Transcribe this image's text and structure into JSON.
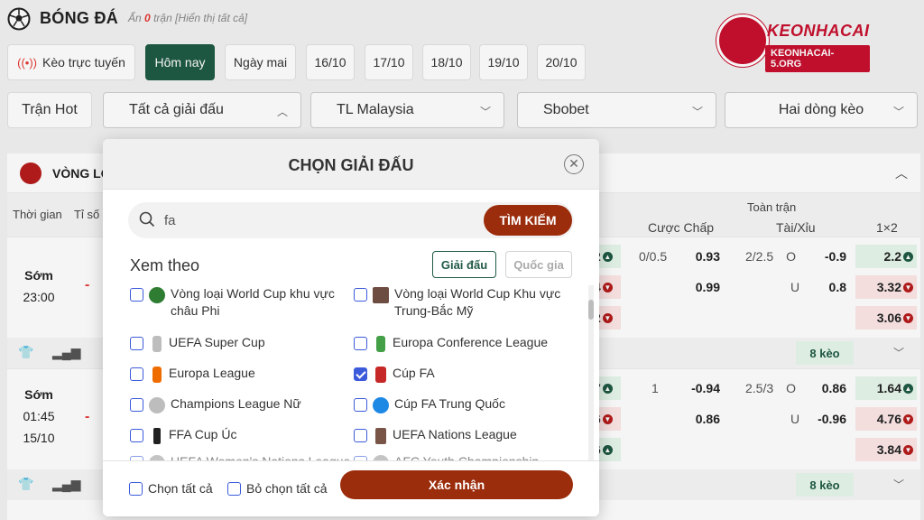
{
  "header": {
    "title": "BÓNG ĐÁ",
    "hidden_prefix": "Ẩn",
    "hidden_count": "0",
    "hidden_suffix": "trận [Hiển thị tất cả]"
  },
  "logo": {
    "brand": "KEONHACAI",
    "domain": "KEONHACAI-5.ORG"
  },
  "tabs": [
    {
      "label": "Kèo trực tuyến",
      "icon": "live-icon"
    },
    {
      "label": "Hôm nay",
      "active": true
    },
    {
      "label": "Ngày mai"
    },
    {
      "label": "16/10"
    },
    {
      "label": "17/10"
    },
    {
      "label": "18/10"
    },
    {
      "label": "19/10"
    },
    {
      "label": "20/10"
    }
  ],
  "filters": {
    "hot": "Trận Hot",
    "league": "Tất cả giải đấu",
    "odds_type": "TL Malaysia",
    "bookmaker": "Sbobet",
    "lines": "Hai dòng kèo"
  },
  "background": {
    "league_name": "VÒNG LOẠI",
    "col_time": "Thời gian",
    "col_score": "Tỉ số",
    "col_full": "Toàn trận",
    "col_handicap": "Cược Chấp",
    "col_ou": "Tài/Xỉu",
    "col_1x2": "1×2",
    "match1": {
      "status": "Sớm",
      "time": "23:00",
      "score": "-",
      "home_odds_partial": "2",
      "away_odds_partial": "4",
      "draw_odds_partial": "2",
      "handicap_line": "0/0.5",
      "handicap_home": "0.93",
      "handicap_away": "0.99",
      "ou_line": "2/2.5",
      "ou_over_label": "O",
      "ou_over": "-0.9",
      "ou_under_label": "U",
      "ou_under": "0.8",
      "x12_home": "2.2",
      "x12_away": "3.32",
      "x12_draw": "3.06",
      "more": "8 kèo"
    },
    "match2": {
      "status": "Sớm",
      "time": "01:45",
      "date": "15/10",
      "score": "-",
      "home_odds_partial": "7",
      "away_odds_partial": "6",
      "draw_odds_partial": "6",
      "handicap_line": "1",
      "handicap_home": "-0.94",
      "handicap_away": "0.86",
      "ou_line": "2.5/3",
      "ou_over_label": "O",
      "ou_over": "0.86",
      "ou_under_label": "U",
      "ou_under": "-0.96",
      "x12_home": "1.64",
      "x12_away": "4.76",
      "x12_draw": "3.84",
      "more": "8 kèo"
    }
  },
  "modal": {
    "title": "CHỌN GIẢI ĐẤU",
    "search_value": "fa",
    "search_button": "TÌM KIẾM",
    "view_label": "Xem theo",
    "view_league": "Giải đấu",
    "view_country": "Quốc gia",
    "leagues": [
      {
        "name": "Vòng loại World Cup khu vực châu Phi",
        "checked": false,
        "color": "#2e7d32"
      },
      {
        "name": "Vòng loại World Cup Khu vực Trung-Bắc Mỹ",
        "checked": false,
        "color": "#6d4c41"
      },
      {
        "name": "UEFA Super Cup",
        "checked": false,
        "color": "#9e9e9e"
      },
      {
        "name": "Europa Conference League",
        "checked": false,
        "color": "#43a047"
      },
      {
        "name": "Europa League",
        "checked": false,
        "color": "#ef6c00"
      },
      {
        "name": "Cúp FA",
        "checked": true,
        "color": "#c62828"
      },
      {
        "name": "Champions League Nữ",
        "checked": false,
        "color": "#9e9e9e"
      },
      {
        "name": "Cúp FA Trung Quốc",
        "checked": false,
        "color": "#1e88e5"
      },
      {
        "name": "FFA Cup Úc",
        "checked": false,
        "color": "#212121"
      },
      {
        "name": "UEFA Nations League",
        "checked": false,
        "color": "#795548"
      },
      {
        "name": "UEFA Women's Nations League",
        "checked": false,
        "color": "#9e9e9e"
      },
      {
        "name": "AFC Youth Championship",
        "checked": false,
        "color": "#9e9e9e"
      }
    ],
    "select_all": "Chọn tất cả",
    "deselect_all": "Bỏ chọn tất cả",
    "confirm": "Xác nhận"
  }
}
